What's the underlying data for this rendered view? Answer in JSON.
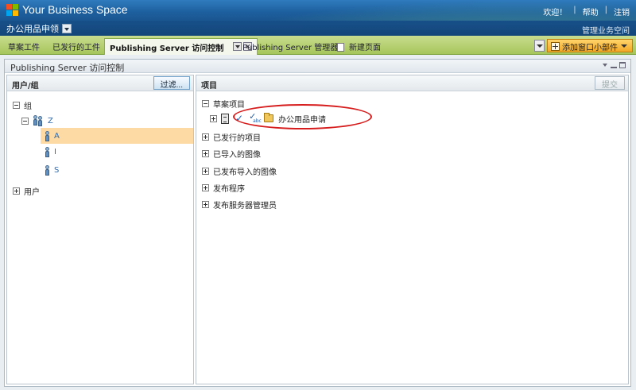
{
  "brand": {
    "title": "Your Business Space"
  },
  "toplinks": {
    "welcome": "欢迎！",
    "help": "帮助",
    "logout": "注销"
  },
  "space": {
    "name": "办公用品申领",
    "manage": "管理业务空间"
  },
  "tabs": {
    "draft": "草案工件",
    "published": "已发行的工件",
    "active": "Publishing Server 访问控制",
    "manager": "Publishing Server 管理器",
    "new_page": "新建页面",
    "add_widget": "添加窗口小部件"
  },
  "widget": {
    "title": "Publishing Server 访问控制",
    "left": {
      "header": "用户/组",
      "filter_button": "过滤...",
      "tree": {
        "groups": "组",
        "group_z": "Z",
        "user_a": "A",
        "user_i": "I",
        "user_s": "S",
        "users": "用户"
      }
    },
    "right": {
      "header": "项目",
      "submit_button": "提交",
      "tree": {
        "draft_items": "草案项目",
        "draft_child": "办公用品申请",
        "published_items": "已发行的项目",
        "imported_images": "已导入的图像",
        "published_imported_images": "已发布导入的图像",
        "publish_programs": "发布程序",
        "publish_server_admins": "发布服务器管理员"
      }
    }
  },
  "colors": {
    "selected_row": "#fdd9a3",
    "highlight_ellipse": "#d61c1c",
    "tabbar_green": "#a6c65b",
    "topbar_blue": "#1d5f9e"
  }
}
